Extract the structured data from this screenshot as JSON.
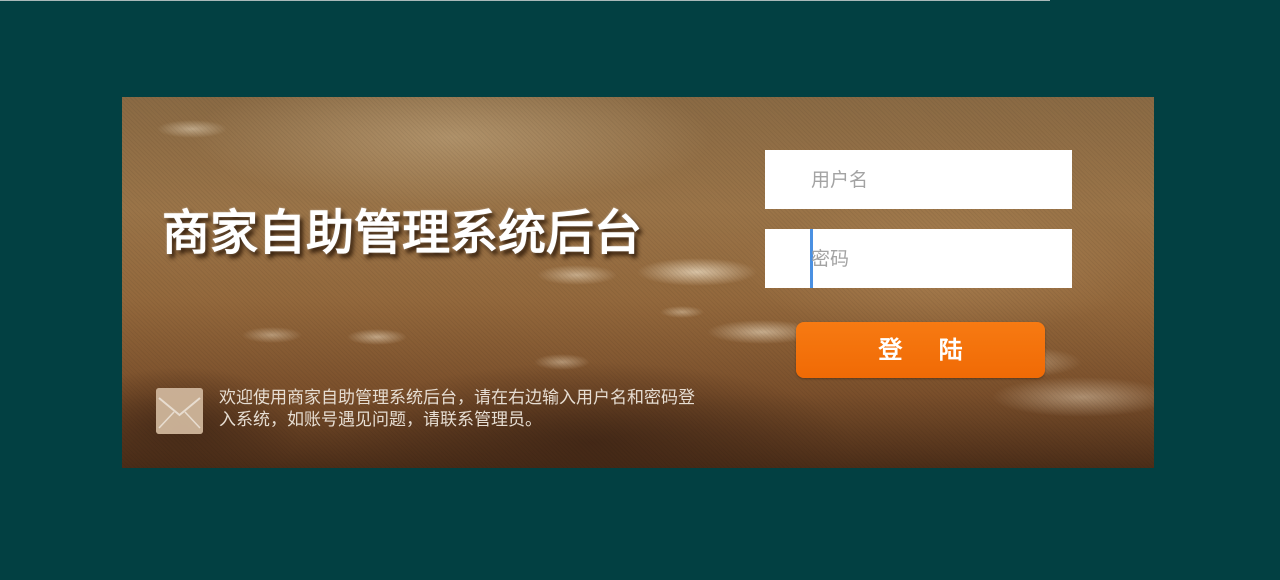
{
  "page": {
    "title": "商家自助管理系统后台"
  },
  "login_form": {
    "username_placeholder": "用户名",
    "password_placeholder": "密码",
    "submit_label": "登 陆"
  },
  "notice": {
    "icon": "envelope-icon",
    "text": "欢迎使用商家自助管理系统后台，请在右边输入用户名和密码登入系统，如账号遇见问题，请联系管理员。"
  },
  "colors": {
    "page_background": "#024042",
    "button": "#f27008",
    "caret": "#4a90e2"
  }
}
